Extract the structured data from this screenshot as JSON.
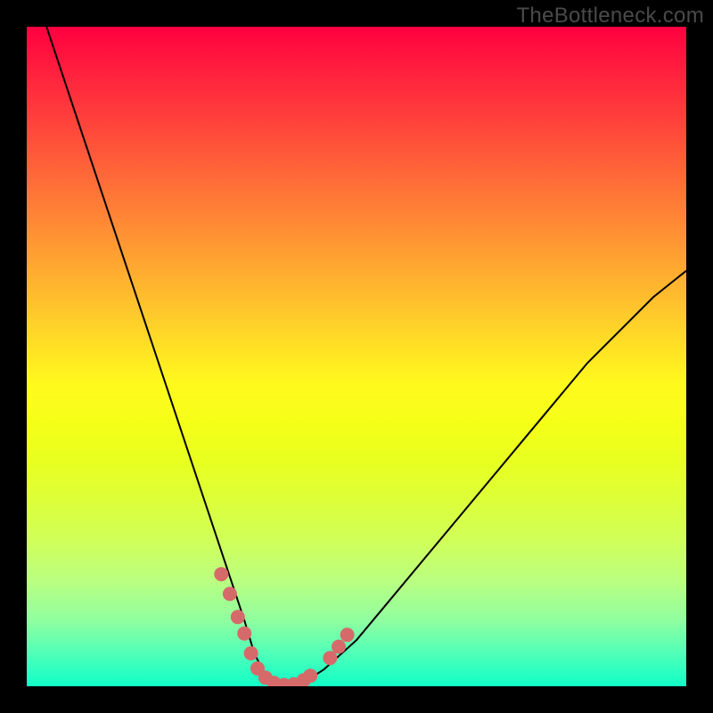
{
  "watermark": "TheBottleneck.com",
  "chart_data": {
    "type": "line",
    "title": "",
    "xlabel": "",
    "ylabel": "",
    "xlim": [
      0,
      100
    ],
    "ylim": [
      0,
      100
    ],
    "grid": false,
    "legend": false,
    "background_gradient": {
      "top": "#ff0040",
      "mid_upper": "#ffa631",
      "mid": "#fff91d",
      "bottom": "#10ffc8"
    },
    "series": [
      {
        "name": "bottleneck-curve",
        "x": [
          3,
          6,
          9,
          12,
          15,
          18,
          21,
          24,
          27,
          30,
          33,
          34.5,
          36,
          38,
          40,
          42,
          45,
          50,
          55,
          60,
          65,
          70,
          75,
          80,
          85,
          90,
          95,
          100
        ],
        "y": [
          100,
          91,
          82,
          73,
          64,
          55,
          46,
          37,
          28,
          19,
          10,
          5,
          2,
          0.3,
          0.2,
          0.6,
          2.5,
          7,
          13,
          19,
          25,
          31,
          37,
          43,
          49,
          54,
          59,
          63
        ]
      }
    ],
    "markers": {
      "name": "highlight-dots",
      "color": "#d66a6a",
      "points_xy": [
        [
          29.5,
          17
        ],
        [
          30.8,
          14
        ],
        [
          32.0,
          10.5
        ],
        [
          33.0,
          8
        ],
        [
          34.0,
          5
        ],
        [
          35.0,
          2.7
        ],
        [
          36.2,
          1.3
        ],
        [
          37.5,
          0.5
        ],
        [
          39.0,
          0.2
        ],
        [
          40.5,
          0.3
        ],
        [
          42.0,
          0.9
        ],
        [
          43.0,
          1.6
        ],
        [
          46.0,
          4.3
        ],
        [
          47.3,
          6.0
        ],
        [
          48.6,
          7.8
        ]
      ]
    }
  }
}
